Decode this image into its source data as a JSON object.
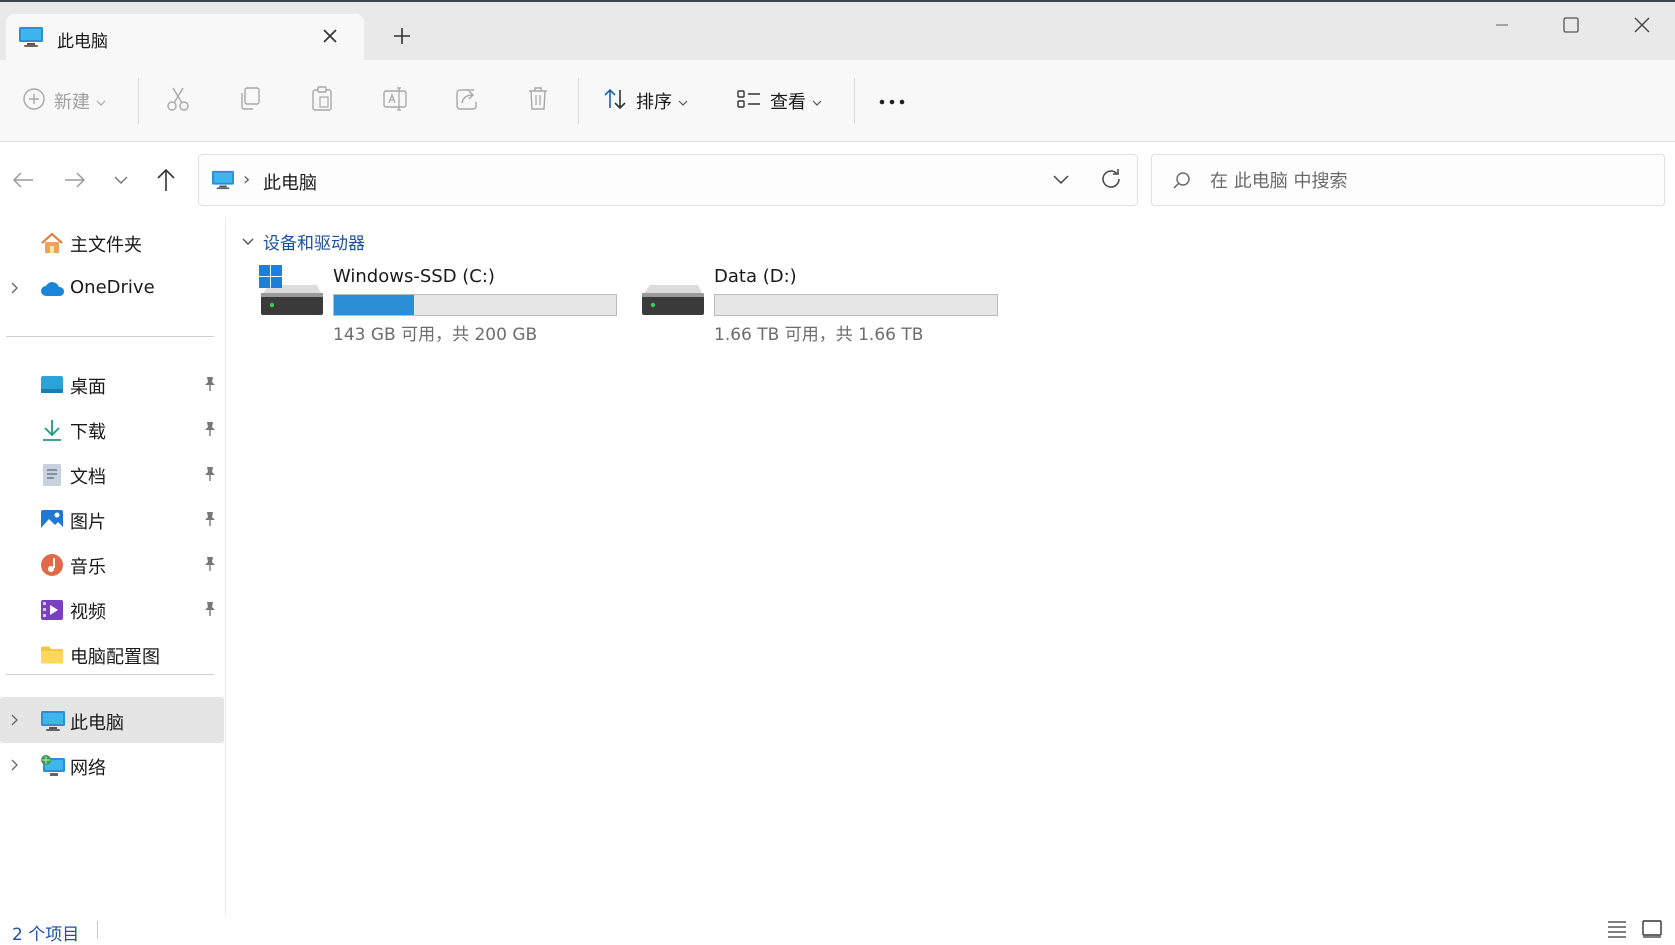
{
  "window": {
    "tab_title": "此电脑",
    "icons": {
      "tab": "computer-icon",
      "close_tab": "close-icon",
      "new_tab": "plus-icon",
      "minimize": "minimize-icon",
      "maximize": "maximize-icon",
      "close": "close-icon"
    }
  },
  "toolbar": {
    "new_label": "新建",
    "sort_label": "排序",
    "view_label": "查看",
    "icons": [
      "add-circle-icon",
      "cut-icon",
      "copy-icon",
      "paste-icon",
      "rename-icon",
      "share-icon",
      "delete-icon",
      "sort-icon",
      "view-icon",
      "more-icon"
    ]
  },
  "address": {
    "breadcrumb": "此电脑",
    "search_placeholder": "在 此电脑 中搜索"
  },
  "sidebar": {
    "top_items": [
      {
        "label": "主文件夹",
        "icon": "home-icon",
        "expandable": false
      },
      {
        "label": "OneDrive",
        "icon": "cloud-icon",
        "expandable": true
      }
    ],
    "pinned_items": [
      {
        "label": "桌面",
        "icon": "desktop-icon",
        "pinned": true
      },
      {
        "label": "下载",
        "icon": "download-icon",
        "pinned": true
      },
      {
        "label": "文档",
        "icon": "document-icon",
        "pinned": true
      },
      {
        "label": "图片",
        "icon": "pictures-icon",
        "pinned": true
      },
      {
        "label": "音乐",
        "icon": "music-icon",
        "pinned": true
      },
      {
        "label": "视频",
        "icon": "video-icon",
        "pinned": true
      },
      {
        "label": "电脑配置图",
        "icon": "folder-icon",
        "pinned": false
      }
    ],
    "bottom_items": [
      {
        "label": "此电脑",
        "icon": "computer-icon",
        "expandable": true,
        "selected": true
      },
      {
        "label": "网络",
        "icon": "network-icon",
        "expandable": true,
        "selected": false
      }
    ]
  },
  "content": {
    "group_header": "设备和驱动器",
    "drives": [
      {
        "name": "Windows-SSD (C:)",
        "free_text": "143 GB 可用，共 200 GB",
        "used_fraction": 0.285,
        "icon": "system-drive-icon"
      },
      {
        "name": "Data (D:)",
        "free_text": "1.66 TB 可用，共 1.66 TB",
        "used_fraction": 0.0,
        "icon": "drive-icon"
      }
    ],
    "colors": {
      "usage_bar": "#2b8fd6",
      "group_header": "#1f4fa0"
    }
  },
  "status": {
    "item_count": "2 个项目"
  }
}
